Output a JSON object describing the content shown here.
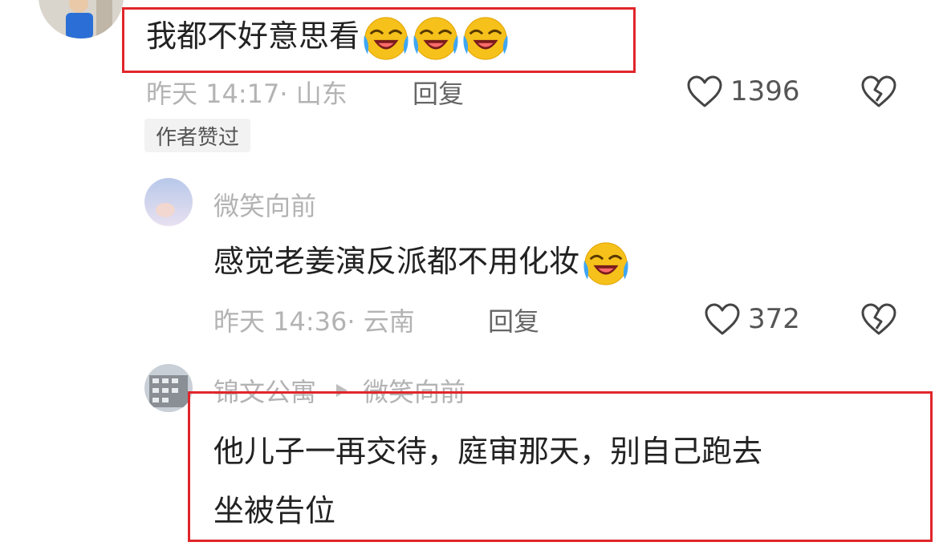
{
  "comments": [
    {
      "text": "我都不好意思看",
      "emoji_count": 3,
      "time": "昨天 14:17",
      "location": "· 山东",
      "reply_label": "回复",
      "likes": "1396",
      "badge": "作者赞过"
    },
    {
      "username": "微笑向前",
      "text": "感觉老姜演反派都不用化妆",
      "emoji_count": 1,
      "time": "昨天 14:36",
      "location": "· 云南",
      "reply_label": "回复",
      "likes": "372"
    },
    {
      "username": "锦文公寓",
      "reply_to": "微笑向前",
      "text_line1": "他儿子一再交待，庭审那天，别自己跑去",
      "text_line2": "坐被告位"
    }
  ],
  "icons": [
    "heart-icon",
    "broken-heart-icon",
    "laughing-crying-emoji",
    "reply-arrow-icon"
  ],
  "colors": {
    "highlight_box": "#e0262b",
    "meta_gray": "#b3b3b3",
    "emoji_yellow": "#f6c11a",
    "emoji_blue": "#3ea6f2"
  }
}
